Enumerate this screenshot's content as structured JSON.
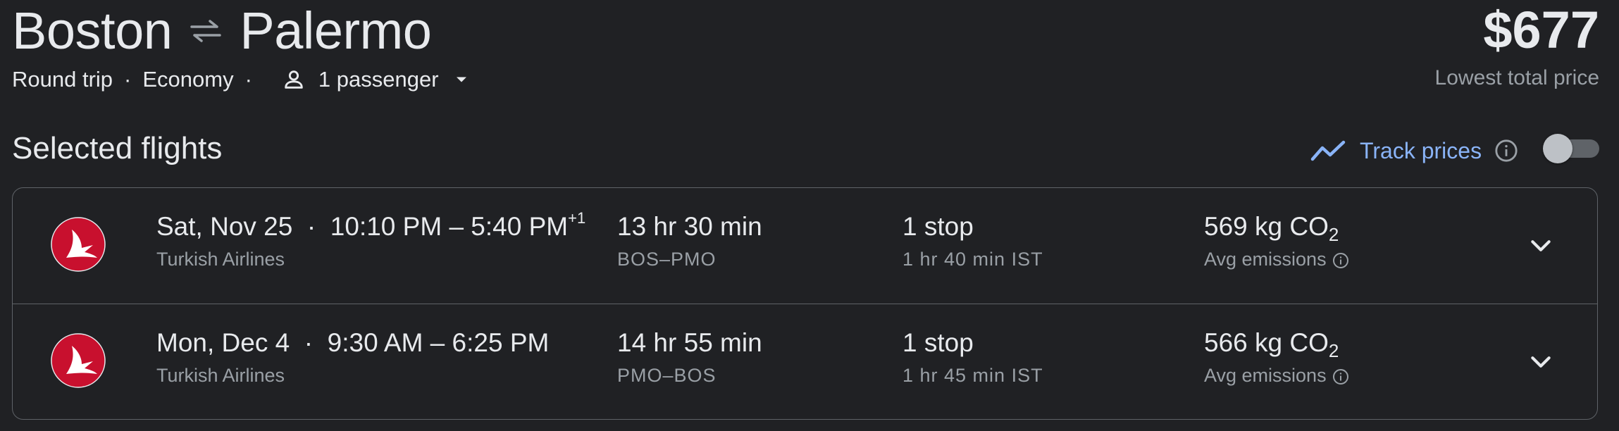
{
  "header": {
    "origin": "Boston",
    "destination": "Palermo",
    "trip_type": "Round trip",
    "cabin": "Economy",
    "passengers": "1 passenger",
    "price": "$677",
    "price_label": "Lowest total price"
  },
  "section": {
    "title": "Selected flights",
    "track_label": "Track prices",
    "track_on": false
  },
  "flights": [
    {
      "date": "Sat, Nov 25",
      "times": "10:10 PM – 5:40 PM",
      "day_offset": "+1",
      "airline": "Turkish Airlines",
      "duration": "13 hr 30 min",
      "route": "BOS–PMO",
      "stops": "1 stop",
      "layover": "1 hr 40 min IST",
      "emissions_value": "569 kg CO",
      "emissions_sub": "2",
      "emissions_label": "Avg emissions"
    },
    {
      "date": "Mon, Dec 4",
      "times": "9:30 AM – 6:25 PM",
      "day_offset": "",
      "airline": "Turkish Airlines",
      "duration": "14 hr 55 min",
      "route": "PMO–BOS",
      "stops": "1 stop",
      "layover": "1 hr 45 min IST",
      "emissions_value": "566 kg CO",
      "emissions_sub": "2",
      "emissions_label": "Avg emissions"
    }
  ],
  "colors": {
    "background": "#202124",
    "accent": "#8ab4f8",
    "logo_red": "#c8102e",
    "muted": "#9aa0a6"
  }
}
